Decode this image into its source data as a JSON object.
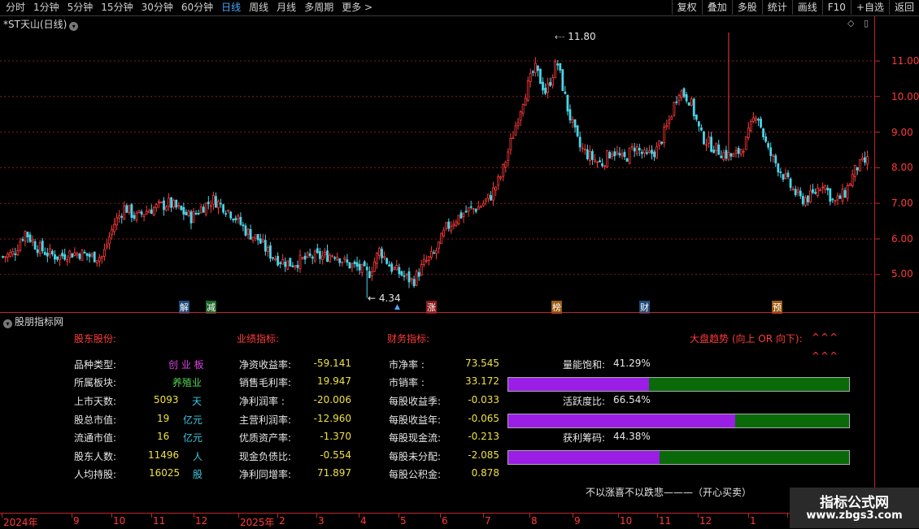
{
  "toolbar": {
    "periods": [
      "分时",
      "1分钟",
      "5分钟",
      "15分钟",
      "30分钟",
      "60分钟",
      "日线",
      "周线",
      "月线",
      "多周期",
      "更多 >"
    ],
    "active_period": "日线",
    "right_buttons": [
      "复权",
      "叠加",
      "多股",
      "统计",
      "画线",
      "F10",
      "+自选",
      "返回"
    ]
  },
  "chart": {
    "title": "*ST天山(日线)",
    "high_label": "11.80",
    "low_label": "4.34",
    "y_ticks": [
      "11.00",
      "10.00",
      "9.00",
      "8.00",
      "7.00",
      "6.00",
      "5.00"
    ],
    "event_markers": [
      "解",
      "减",
      "涨",
      "榜",
      "财",
      "预"
    ],
    "colors": {
      "up": "#ff3a3a",
      "down": "#4ad4e8",
      "grid": "#8a1a1a",
      "axis": "#c0262a"
    }
  },
  "chart_data": {
    "type": "candlestick",
    "y_range": [
      4.0,
      12.0
    ],
    "y_ticks": [
      5,
      6,
      7,
      8,
      9,
      10,
      11
    ],
    "high": 11.8,
    "low": 4.34,
    "close_trend": [
      5.5,
      5.6,
      6.2,
      5.8,
      5.6,
      5.5,
      5.6,
      5.6,
      5.5,
      5.5,
      6.4,
      6.9,
      6.6,
      6.8,
      6.9,
      7.0,
      6.8,
      6.6,
      6.9,
      7.1,
      6.9,
      6.6,
      6.2,
      6.0,
      5.6,
      5.4,
      5.3,
      5.4,
      5.5,
      5.5,
      5.6,
      5.3,
      5.2,
      5.0,
      5.7,
      5.2,
      5.0,
      4.8,
      5.3,
      5.6,
      6.3,
      6.6,
      6.8,
      6.9,
      7.2,
      7.8,
      8.9,
      10.0,
      10.8,
      10.1,
      11.0,
      9.6,
      8.6,
      8.3,
      8.1,
      8.5,
      8.2,
      8.6,
      8.3,
      8.5,
      9.2,
      10.2,
      9.9,
      8.9,
      8.6,
      8.4,
      8.3,
      8.7,
      9.6,
      8.5,
      8.0,
      7.5,
      7.1,
      7.2,
      7.6,
      7.0,
      7.3,
      8.0,
      8.2
    ]
  },
  "indicator": {
    "title": "股朋指标网",
    "col1_header": "股东股份:",
    "col1_labels": [
      "品种类型:",
      "所属板块:",
      "上市天数:",
      "股总市值:",
      "流通市值:",
      "股东人数:",
      "人均持股:"
    ],
    "board_type": "创 业 板",
    "sector": "养殖业",
    "listing_days": "5093",
    "listing_days_unit": "天",
    "total_cap": "19",
    "total_cap_unit": "亿元",
    "float_cap": "16",
    "float_cap_unit": "亿元",
    "holders": "11496",
    "holders_unit": "人",
    "per_holder": "16025",
    "per_holder_unit": "股",
    "col2_header": "业绩指标:",
    "col2_rows": [
      {
        "label": "净资收益率:",
        "value": "-59.141"
      },
      {
        "label": "销售毛利率:",
        "value": "19.947"
      },
      {
        "label": "净利润率  :",
        "value": "-20.006"
      },
      {
        "label": "主营利润率:",
        "value": "-12.960"
      },
      {
        "label": "优质资产率:",
        "value": "-1.370"
      },
      {
        "label": "现金负债比:",
        "value": "-0.554"
      },
      {
        "label": "净利同增率:",
        "value": "71.897"
      }
    ],
    "col3_header": "财务指标:",
    "col3_rows": [
      {
        "label": "市净率    :",
        "value": "73.545"
      },
      {
        "label": "市销率    :",
        "value": "33.172"
      },
      {
        "label": "每股收益季:",
        "value": "-0.033"
      },
      {
        "label": "每股收益年:",
        "value": "-0.065"
      },
      {
        "label": "每股现金流:",
        "value": "-0.213"
      },
      {
        "label": "每股未分配:",
        "value": "-2.085"
      },
      {
        "label": "每股公积金:",
        "value": "0.878"
      }
    ],
    "trend_label": "大盘趋势 (向上 OR 向下):",
    "trend_arrows1": "^^^",
    "trend_arrows2": "^^^",
    "bars": [
      {
        "label": "量能饱和:",
        "value": "41.29%",
        "fraction": 0.4129
      },
      {
        "label": "活跃度比:",
        "value": "66.54%",
        "fraction": 0.6654
      },
      {
        "label": "获利筹码:",
        "value": "44.38%",
        "fraction": 0.4438
      }
    ],
    "slogan": "不以涨喜不以跌悲———（开心买卖）"
  },
  "xaxis": {
    "labels": [
      "2024年",
      "9",
      "10",
      "11",
      "12",
      "2025年",
      "2",
      "3",
      "4",
      "5",
      "6",
      "7",
      "8",
      "9",
      "10",
      "11",
      "12",
      "1",
      "2"
    ]
  },
  "watermark": {
    "line1": "指标公式网",
    "line2": "www.zbgs3.com"
  }
}
